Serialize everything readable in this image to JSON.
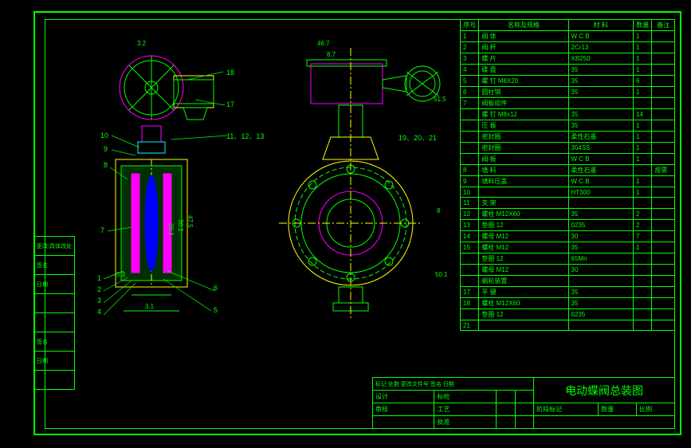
{
  "title_block": {
    "main_title": "电动蝶阀总装图",
    "rows": [
      [
        "阶段标记",
        "数量",
        "比例"
      ],
      [
        "",
        "",
        ""
      ],
      [
        "设计",
        "标检",
        "",
        ""
      ],
      [
        "审核",
        "工艺",
        "",
        ""
      ],
      [
        "",
        "批准",
        "",
        ""
      ]
    ],
    "small_labels": [
      "标记",
      "处数",
      "更改文件号",
      "签名",
      "日期"
    ]
  },
  "parts_header": [
    "序号",
    "名称及规格",
    "材 料",
    "数量",
    "备注"
  ],
  "parts_list": [
    [
      "1",
      "阀 体",
      "W C B",
      "1",
      ""
    ],
    [
      "2",
      "阀 杆",
      "2Cr13",
      "1",
      ""
    ],
    [
      "3",
      "蝶 片",
      "XB250",
      "1",
      ""
    ],
    [
      "4",
      "碟 盘",
      "35",
      "1",
      ""
    ],
    [
      "5",
      "螺 钉 M8X20",
      "35",
      "6",
      ""
    ],
    [
      "6",
      "圆柱销",
      "35",
      "1",
      ""
    ],
    [
      "7",
      "阀板组件",
      "",
      "",
      ""
    ],
    [
      "",
      "螺 钉 M8x12",
      "35",
      "14",
      ""
    ],
    [
      "",
      "压 板",
      "35",
      "1",
      ""
    ],
    [
      "",
      "密封圈",
      "柔性石墨",
      "1",
      ""
    ],
    [
      "",
      "密封圈",
      "304SS",
      "1",
      ""
    ],
    [
      "",
      "阀 板",
      "W C B",
      "1",
      ""
    ],
    [
      "8",
      "填 料",
      "柔性石墨",
      "",
      "按需"
    ],
    [
      "9",
      "填料压盖",
      "W C B",
      "1",
      ""
    ],
    [
      "10",
      "",
      "HT300",
      "1",
      ""
    ],
    [
      "11",
      "支 架",
      "",
      "",
      ""
    ],
    [
      "12",
      "螺栓 M12X60",
      "35",
      "2",
      ""
    ],
    [
      "13",
      "垫圈 12",
      "0235",
      "2",
      ""
    ],
    [
      "14",
      "螺母 M12",
      "30",
      "7",
      ""
    ],
    [
      "15",
      "螺栓 M12",
      "35",
      "1",
      ""
    ],
    [
      "",
      "垫圈 12",
      "65Mn",
      "",
      ""
    ],
    [
      "",
      "螺母 M12",
      "30",
      "",
      ""
    ],
    [
      "",
      "蜗轮装置",
      "",
      "",
      ""
    ],
    [
      "17",
      "平 键",
      "35",
      "",
      ""
    ],
    [
      "18",
      "螺栓 M12X60",
      "35",
      "",
      ""
    ],
    [
      "",
      "垫圈 12",
      "0235",
      "",
      ""
    ],
    [
      "21",
      "",
      "",
      "",
      ""
    ]
  ],
  "left_strip": [
    "更改:具体改处",
    "签名",
    "日期",
    "",
    "",
    "签名",
    "日期",
    ""
  ],
  "callouts_left": [
    "10",
    "9",
    "8",
    "7",
    "1",
    "2",
    "3",
    "4"
  ],
  "callouts_right": [
    "18",
    "17",
    "11、12、13",
    "6",
    "5"
  ],
  "callouts_view2": [
    "19、20、21"
  ],
  "dimensions": {
    "top1": "3.2",
    "top2": "46.7",
    "top3": "8.7",
    "right1": "51.5",
    "right2": "8",
    "right3": "50.1",
    "mid1": "20.1",
    "mid2": "30.1",
    "mid3": "47.5",
    "bot1": "0.3",
    "bot2": "3.1"
  }
}
